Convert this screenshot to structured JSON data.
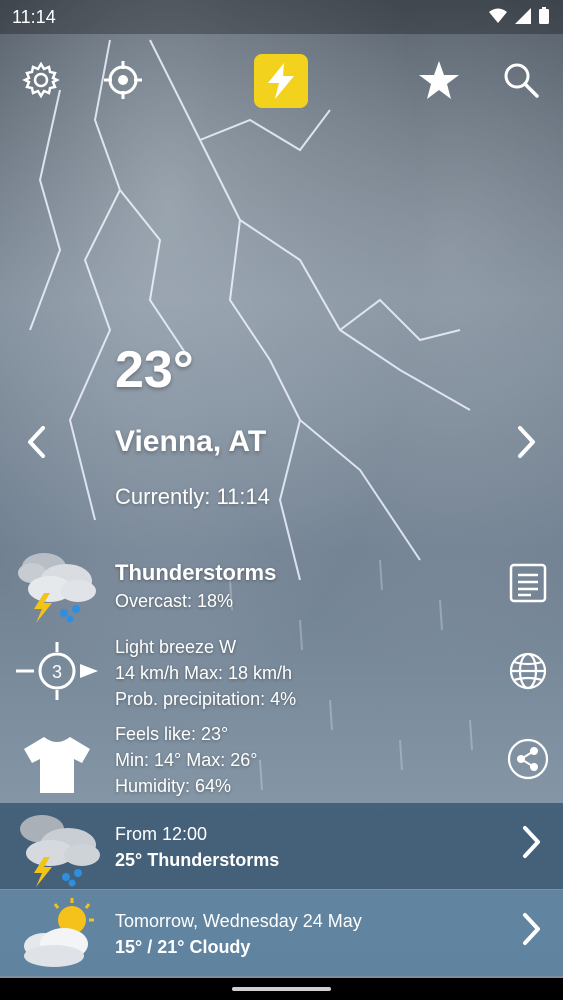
{
  "status_bar": {
    "time": "11:14"
  },
  "current": {
    "temperature": "23°",
    "city": "Vienna, AT",
    "currently": "Currently: 11:14"
  },
  "details": {
    "condition": "Thunderstorms",
    "overcast": "Overcast: 18%",
    "wind_label": "Light breeze W",
    "wind_speed": "14 km/h Max: 18 km/h",
    "precipitation": "Prob. precipitation: 4%",
    "wind_badge": "3",
    "feels_like": "Feels like: 23°",
    "min_max": "Min: 14° Max: 26°",
    "humidity": "Humidity: 64%"
  },
  "forecast": [
    {
      "when": "From 12:00",
      "summary": "25° Thunderstorms"
    },
    {
      "when": "Tomorrow, Wednesday 24 May",
      "summary": "15° / 21° Cloudy"
    }
  ],
  "icons": {
    "toolbar": [
      "gear-icon",
      "location-target-icon",
      "lightning-icon",
      "star-icon",
      "search-icon"
    ],
    "side": [
      "report-icon",
      "globe-icon",
      "share-icon"
    ]
  },
  "colors": {
    "accent": "#f2d21c",
    "forecast_row_1": "#2e4e69",
    "forecast_row_2": "#5680a0"
  }
}
